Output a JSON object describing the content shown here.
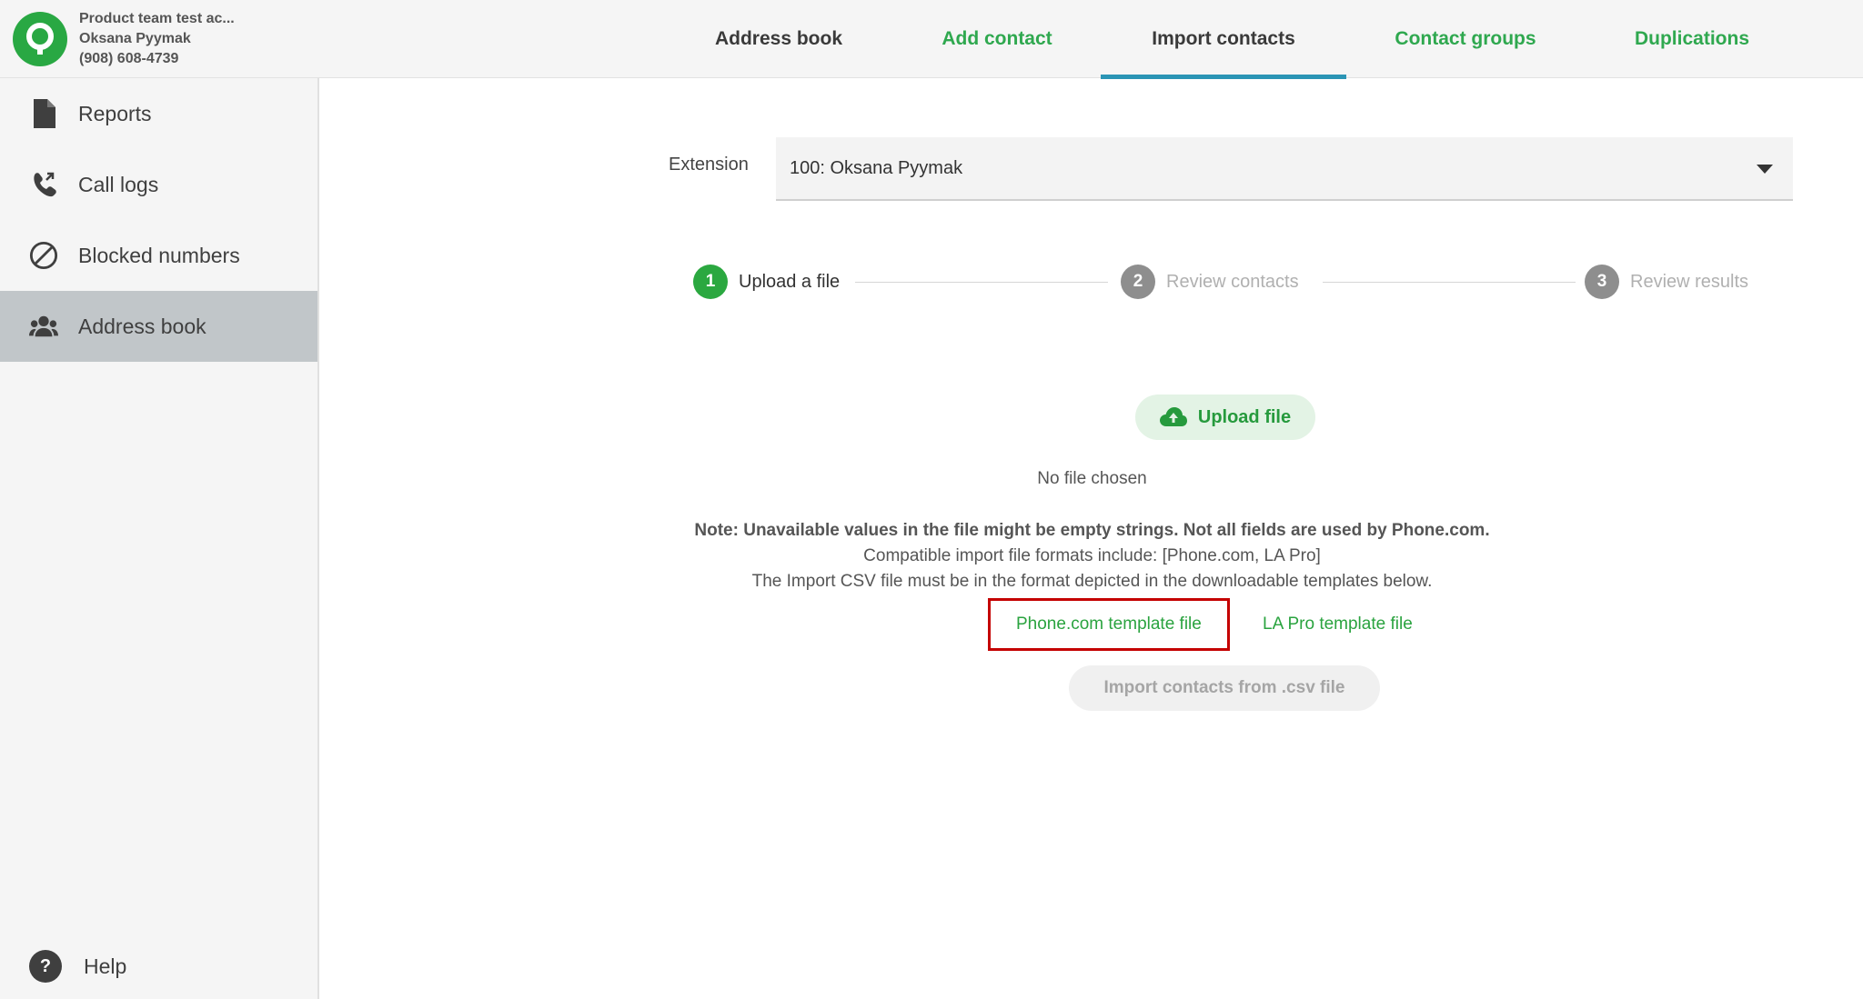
{
  "account": {
    "name": "Product team test ac...",
    "user": "Oksana Pyymak",
    "phone": "(908) 608-4739"
  },
  "tabs": [
    {
      "label": "Address book",
      "active": false
    },
    {
      "label": "Add contact",
      "active": false
    },
    {
      "label": "Import contacts",
      "active": true
    },
    {
      "label": "Contact groups",
      "active": false
    },
    {
      "label": "Duplications",
      "active": false
    }
  ],
  "sidebar": {
    "items": [
      {
        "label": "Reports",
        "icon": "file-icon"
      },
      {
        "label": "Call logs",
        "icon": "phone-calls-icon"
      },
      {
        "label": "Blocked numbers",
        "icon": "blocked-icon"
      },
      {
        "label": "Address book",
        "icon": "people-icon",
        "active": true
      }
    ],
    "help": "Help"
  },
  "extension": {
    "label": "Extension",
    "value": "100: Oksana Pyymak"
  },
  "steps": [
    {
      "num": "1",
      "label": "Upload a file",
      "active": true
    },
    {
      "num": "2",
      "label": "Review contacts",
      "active": false
    },
    {
      "num": "3",
      "label": "Review results",
      "active": false
    }
  ],
  "upload": {
    "button": "Upload file",
    "status": "No file chosen"
  },
  "note": {
    "line1": "Note: Unavailable values in the file might be empty strings. Not all fields are used by Phone.com.",
    "line2": "Compatible import file formats include: [Phone.com, LA Pro]",
    "line3": "The Import CSV file must be in the format depicted in the downloadable templates below."
  },
  "templates": {
    "phonecom": "Phone.com template file",
    "lapro": "LA Pro template file"
  },
  "import_button": "Import contacts from .csv file",
  "colors": {
    "brand_green": "#2ba840",
    "active_tab_underline": "#2b95b5",
    "highlight_box": "#c40000"
  }
}
